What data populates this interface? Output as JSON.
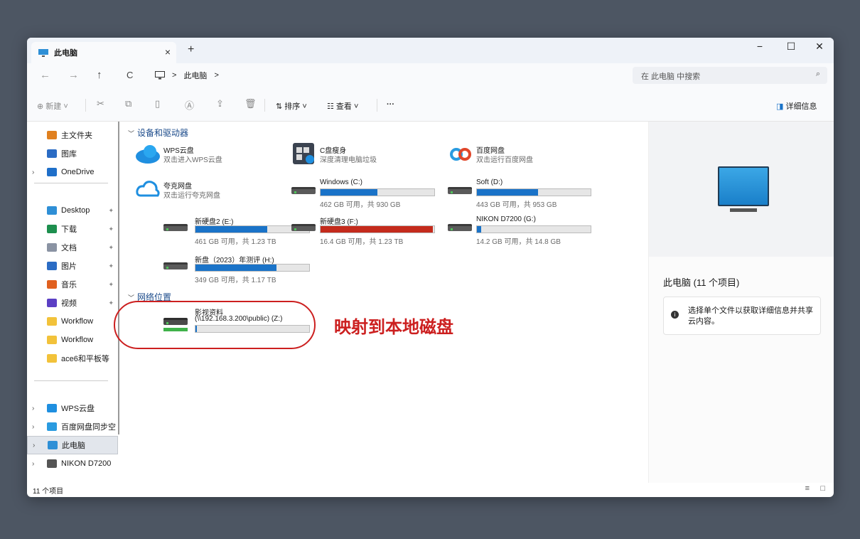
{
  "window": {
    "tab_title": "此电脑",
    "tab_close": "×",
    "new_tab": "+",
    "minimize": "−",
    "maximize": "☐",
    "close": "✕"
  },
  "nav": {
    "back": "←",
    "forward": "→",
    "up": "↑",
    "refresh": "C",
    "breadcrumb_sep": ">",
    "breadcrumb_item": "此电脑",
    "breadcrumb_sep2": ">"
  },
  "search": {
    "placeholder": "在 此电脑 中搜索",
    "icon": "search-icon"
  },
  "toolbar": {
    "new_label": "新建",
    "sort_label": "排序",
    "view_label": "查看",
    "more": "···",
    "details_label": "详细信息"
  },
  "sidebar": {
    "items": [
      {
        "label": "主文件夹",
        "icon": "home-icon",
        "color": "#e0801f",
        "pinned": false,
        "chevron": false
      },
      {
        "label": "图库",
        "icon": "gallery-icon",
        "color": "#2b6cc4",
        "pinned": false,
        "chevron": false
      },
      {
        "label": "OneDrive",
        "icon": "onedrive-icon",
        "color": "#1f6fc9",
        "pinned": false,
        "chevron": true
      },
      {
        "label": "Desktop",
        "icon": "desktop-icon",
        "color": "#2e8fd6",
        "pinned": true,
        "chevron": false
      },
      {
        "label": "下载",
        "icon": "download-icon",
        "color": "#1d8f4e",
        "pinned": true,
        "chevron": false
      },
      {
        "label": "文档",
        "icon": "document-icon",
        "color": "#8a93a3",
        "pinned": true,
        "chevron": false
      },
      {
        "label": "图片",
        "icon": "pictures-icon",
        "color": "#2b6cc4",
        "pinned": true,
        "chevron": false
      },
      {
        "label": "音乐",
        "icon": "music-icon",
        "color": "#e0601f",
        "pinned": true,
        "chevron": false
      },
      {
        "label": "视频",
        "icon": "video-icon",
        "color": "#5b3fc4",
        "pinned": true,
        "chevron": false
      },
      {
        "label": "Workflow",
        "icon": "folder-icon",
        "color": "#f2c23a",
        "pinned": false,
        "chevron": false
      },
      {
        "label": "Workflow",
        "icon": "folder-icon",
        "color": "#f2c23a",
        "pinned": false,
        "chevron": false
      },
      {
        "label": "ace6和平板等",
        "icon": "folder-icon",
        "color": "#f2c23a",
        "pinned": false,
        "chevron": false
      },
      {
        "label": "WPS云盘",
        "icon": "wps-cloud-icon",
        "color": "#1f8fe0",
        "pinned": false,
        "chevron": true
      },
      {
        "label": "百度网盘同步空",
        "icon": "baidu-icon",
        "color": "#2a9be0",
        "pinned": false,
        "chevron": true
      },
      {
        "label": "此电脑",
        "icon": "pc-icon",
        "color": "#2e8fd6",
        "pinned": false,
        "chevron": true
      },
      {
        "label": "NIKON D7200",
        "icon": "drive-icon",
        "color": "#555555",
        "pinned": false,
        "chevron": true
      }
    ]
  },
  "content": {
    "group_devices": "设备和驱动器",
    "group_network": "网络位置",
    "apps": [
      {
        "name": "WPS云盘",
        "sub": "双击进入WPS云盘",
        "icon": "wps-cloud-icon"
      },
      {
        "name": "C盘瘦身",
        "sub": "深度清理电脑垃圾",
        "icon": "c-drive-clean-icon"
      },
      {
        "name": "百度网盘",
        "sub": "双击运行百度网盘",
        "icon": "baidu-netdisk-icon"
      },
      {
        "name": "夸克网盘",
        "sub": "双击运行夸克网盘",
        "icon": "quark-cloud-icon"
      }
    ],
    "drives": [
      {
        "name": "Windows (C:)",
        "free": "462 GB 可用，共 930 GB",
        "used_fraction": 0.5,
        "critical": false
      },
      {
        "name": "Soft (D:)",
        "free": "443 GB 可用，共 953 GB",
        "used_fraction": 0.54,
        "critical": false
      },
      {
        "name": "新硬盘2 (E:)",
        "free": "461 GB 可用，共 1.23 TB",
        "used_fraction": 0.63,
        "critical": false
      },
      {
        "name": "新硬盘3 (F:)",
        "free": "16.4 GB 可用，共 1.23 TB",
        "used_fraction": 0.99,
        "critical": true
      },
      {
        "name": "NIKON D7200 (G:)",
        "free": "14.2 GB 可用，共 14.8 GB",
        "used_fraction": 0.04,
        "critical": false
      },
      {
        "name": "新盘（2023）年测评 (H:)",
        "free": "349 GB 可用，共 1.17 TB",
        "used_fraction": 0.71,
        "critical": false
      }
    ],
    "network": [
      {
        "name": "影视资料",
        "path": "(\\\\192.168.3.200\\public) (Z:)",
        "used_fraction": 0.01
      }
    ]
  },
  "annotation": {
    "text": "映射到本地磁盘",
    "color": "#cc1f1f"
  },
  "detail": {
    "title": "此电脑 (11 个项目)",
    "message": "选择单个文件以获取详细信息并共享云内容。"
  },
  "status": {
    "count": "11 个项目"
  },
  "colors": {
    "accent": "#1a73c8",
    "critical": "#c42b1c"
  }
}
